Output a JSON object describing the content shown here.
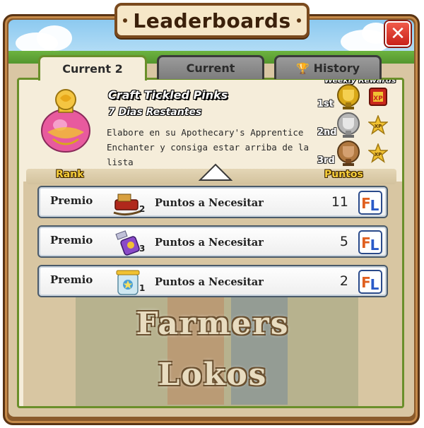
{
  "window": {
    "title": "Leaderboards",
    "close_symbol": "✕"
  },
  "tabs": [
    {
      "label": "Current 2",
      "active": true
    },
    {
      "label": "Current",
      "active": false
    },
    {
      "label": "History",
      "active": false,
      "icon": "trophy-icon"
    }
  ],
  "quest": {
    "title": "Craft Tickled Pinks",
    "days_left": "7 Dias Restantes",
    "description_line1": "Elabore en su Apothecary's Apprentice",
    "description_line2": "Enchanter y consiga estar arriba de la lista"
  },
  "weekly_rewards": {
    "title": "Weekly Rewards",
    "places": [
      {
        "place": "1st",
        "trophy": "gold-trophy-icon",
        "reward": "xp-book-icon"
      },
      {
        "place": "2nd",
        "trophy": "silver-trophy-icon",
        "reward": "xp-star-icon"
      },
      {
        "place": "3rd",
        "trophy": "bronze-trophy-icon",
        "reward": "xp-star-icon"
      }
    ]
  },
  "table": {
    "rank_header": "Rank",
    "points_header": "Puntos",
    "rows": [
      {
        "label": "Premio",
        "item_icon": "sleigh-icon",
        "qty": "2",
        "desc": "Puntos a Necesitar",
        "points": "11"
      },
      {
        "label": "Premio",
        "item_icon": "spray-bottle-icon",
        "qty": "3",
        "desc": "Puntos a Necesitar",
        "points": "5"
      },
      {
        "label": "Premio",
        "item_icon": "glass-jar-icon",
        "qty": "1",
        "desc": "Puntos a Necesitar",
        "points": "2"
      }
    ]
  },
  "watermark": {
    "line1": "Farmers",
    "line2": "Lokos"
  },
  "colors": {
    "frame": "#8a5a2b",
    "panel_bg": "#f5edda",
    "tab_active_border": "#6a8f2a",
    "close_red": "#d8281c",
    "gold_text": "#f7cf3a"
  }
}
